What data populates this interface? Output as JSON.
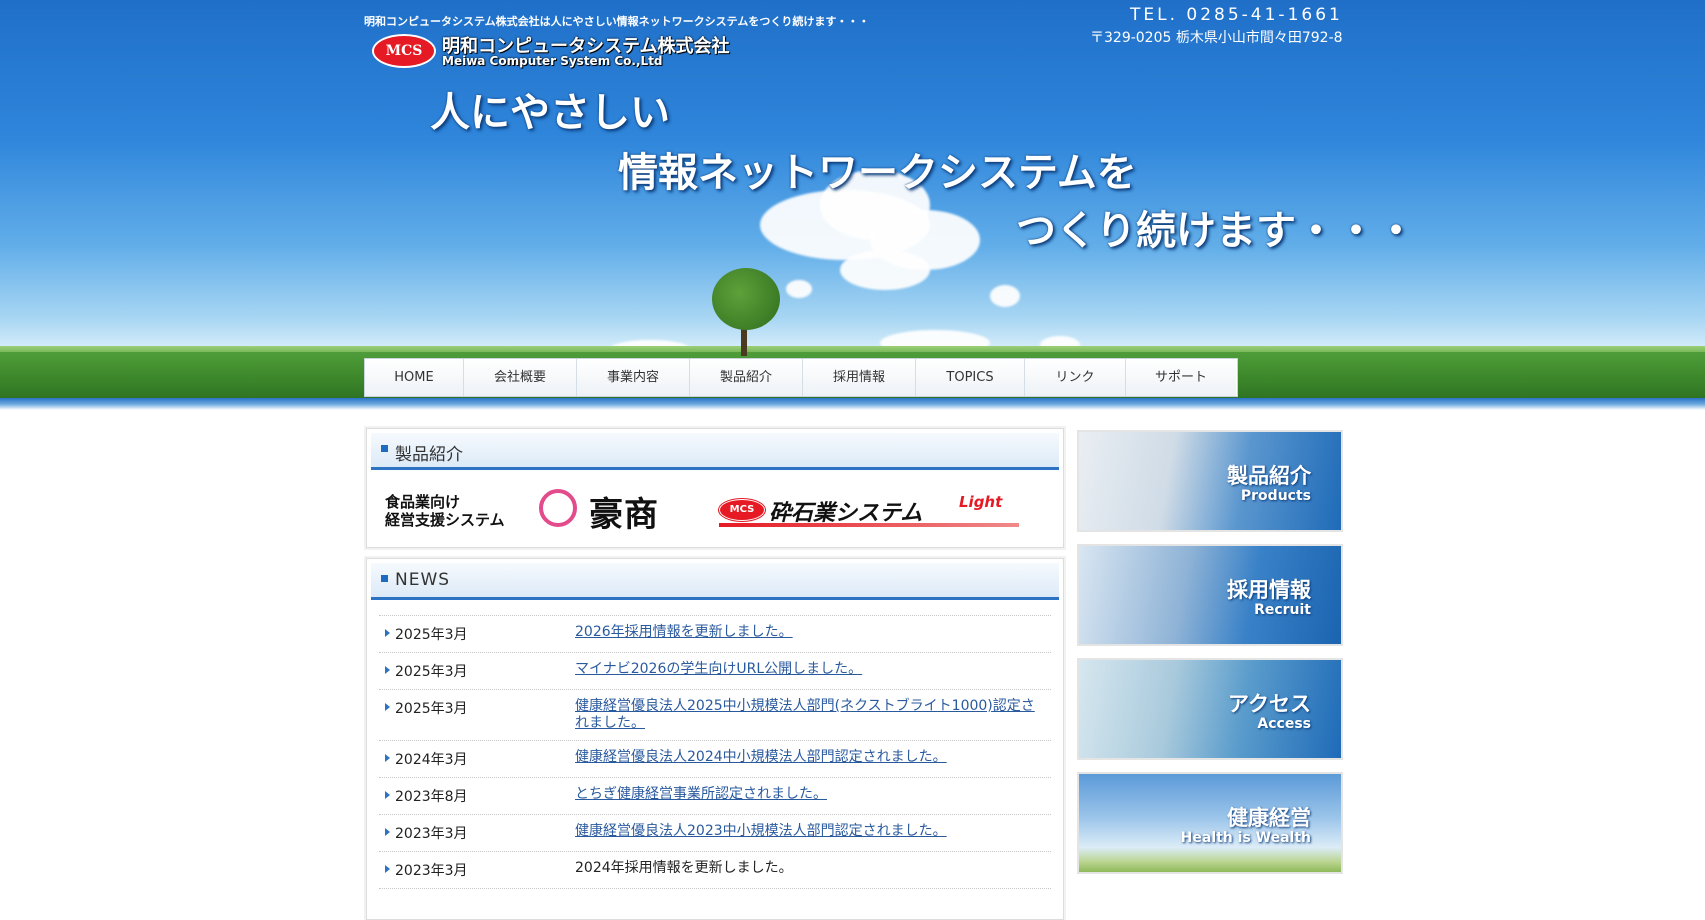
{
  "header": {
    "tagline": "明和コンピュータシステム株式会社は人にやさしい情報ネットワークシステムをつくり続けます・・・",
    "logo_mark": "MCS",
    "company_jp": "明和コンピュータシステム株式会社",
    "company_en": "Meiwa Computer System Co.,Ltd",
    "tel": "TEL. 0285-41-1661",
    "address": "〒329-0205 栃木県小山市間々田792-8"
  },
  "hero": {
    "line1": "人にやさしい",
    "line2": "情報ネットワークシステムを",
    "line3": "つくり続けます・・・"
  },
  "nav": {
    "items": [
      {
        "label": "HOME"
      },
      {
        "label": "会社概要"
      },
      {
        "label": "事業内容"
      },
      {
        "label": "製品紹介"
      },
      {
        "label": "採用情報"
      },
      {
        "label": "TOPICS"
      },
      {
        "label": "リンク"
      },
      {
        "label": "サポート"
      }
    ]
  },
  "products": {
    "heading": "製品紹介",
    "food_line1": "食品業向け",
    "food_line2": "経営支援システム",
    "gousho": "豪商",
    "saiseki_mark": "MCS",
    "saiseki_name": "砕石業システム",
    "saiseki_suffix": "Light"
  },
  "news": {
    "heading": "NEWS",
    "items": [
      {
        "date": "2025年3月",
        "text": "2026年採用情報を更新しました。",
        "link": true
      },
      {
        "date": "2025年3月",
        "text": "マイナビ2026の学生向けURL公開しました。",
        "link": true
      },
      {
        "date": "2025年3月",
        "text": "健康経営優良法人2025中小規模法人部門(ネクストブライト1000)認定されました。",
        "link": true
      },
      {
        "date": "2024年3月",
        "text": "健康経営優良法人2024中小規模法人部門認定されました。",
        "link": true
      },
      {
        "date": "2023年8月",
        "text": "とちぎ健康経営事業所認定されました。",
        "link": true
      },
      {
        "date": "2023年3月",
        "text": "健康経営優良法人2023中小規模法人部門認定されました。",
        "link": true
      },
      {
        "date": "2023年3月",
        "text": "2024年採用情報を更新しました。",
        "link": false
      }
    ]
  },
  "sidebar": {
    "banners": [
      {
        "jp": "製品紹介",
        "en": "Products"
      },
      {
        "jp": "採用情報",
        "en": "Recruit"
      },
      {
        "jp": "アクセス",
        "en": "Access"
      },
      {
        "jp": "健康経営",
        "en": "Health is Wealth"
      }
    ]
  },
  "colors": {
    "accent_blue": "#2c73c3",
    "link_blue": "#2a5a9e",
    "logo_red": "#e51a24"
  }
}
